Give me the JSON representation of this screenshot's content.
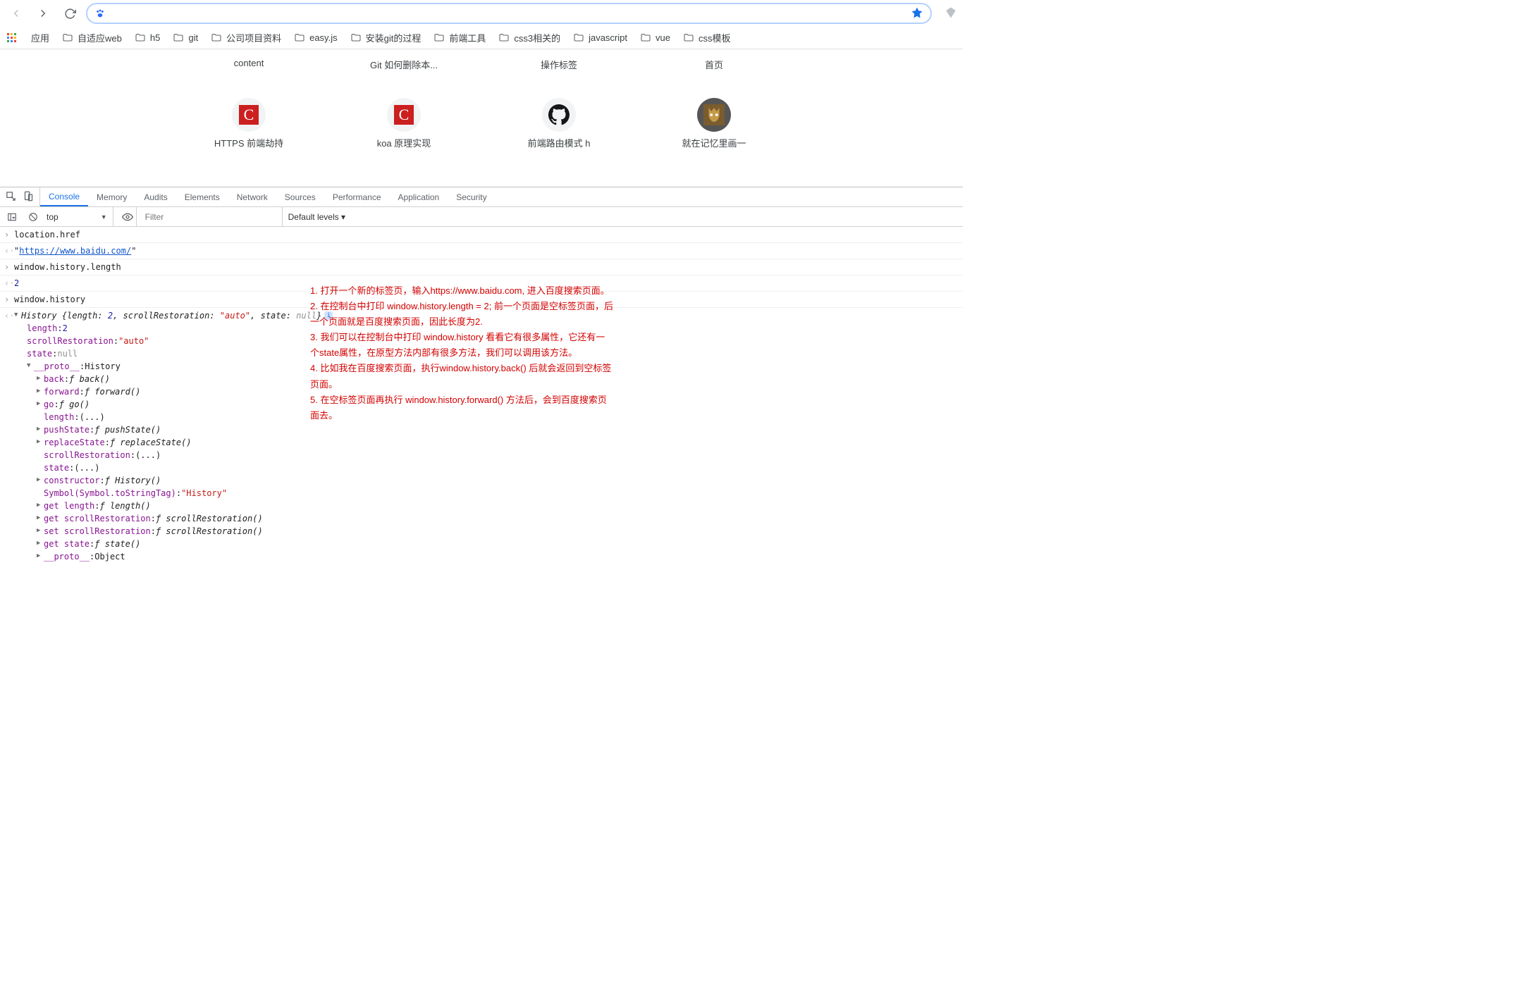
{
  "toolbar": {
    "url_value": ""
  },
  "bookmarks": {
    "apps_label": "应用",
    "items": [
      "自适应web",
      "h5",
      "git",
      "公司项目资料",
      "easy.js",
      "安装git的过程",
      "前端工具",
      "css3相关的",
      "javascript",
      "vue",
      "css模板"
    ]
  },
  "newtab": {
    "row1": [
      "content",
      "Git 如何删除本...",
      "操作标签",
      "首页"
    ],
    "row2_labels": [
      "HTTPS 前端劫持",
      "koa 原理实现",
      "前端路由模式 h",
      "就在记忆里画一"
    ]
  },
  "devtools": {
    "tabs": [
      "Console",
      "Memory",
      "Audits",
      "Elements",
      "Network",
      "Sources",
      "Performance",
      "Application",
      "Security"
    ],
    "active_tab": "Console",
    "context": "top",
    "filter_placeholder": "Filter",
    "levels": "Default levels ▾"
  },
  "console": {
    "line1_in": "location.href",
    "line1_out_prefix": "\"",
    "line1_out_link": "https://www.baidu.com/",
    "line1_out_suffix": "\"",
    "line2_in": "window.history.length",
    "line2_out": "2",
    "line3_in": "window.history",
    "history_summary_1": "History {length: ",
    "history_summary_2": "2",
    "history_summary_3": ", scrollRestoration: ",
    "history_summary_4": "\"auto\"",
    "history_summary_5": ", state: ",
    "history_summary_6": "null",
    "history_summary_7": "}",
    "props": {
      "length_k": "length",
      "length_v": "2",
      "scrollRestoration_k": "scrollRestoration",
      "scrollRestoration_v": "\"auto\"",
      "state_k": "state",
      "state_v": "null",
      "proto_k": "__proto__",
      "proto_v": "History",
      "back_k": "back",
      "back_v": "back()",
      "forward_k": "forward",
      "forward_v": "forward()",
      "go_k": "go",
      "go_v": "go()",
      "length2_k": "length",
      "length2_v": "(...)",
      "pushState_k": "pushState",
      "pushState_v": "pushState()",
      "replaceState_k": "replaceState",
      "replaceState_v": "replaceState()",
      "scrollRestoration2_k": "scrollRestoration",
      "scrollRestoration2_v": "(...)",
      "state2_k": "state",
      "state2_v": "(...)",
      "constructor_k": "constructor",
      "constructor_v": "History()",
      "symbol_k": "Symbol(Symbol.toStringTag)",
      "symbol_v": "\"History\"",
      "get_length_k": "get length",
      "get_length_v": "length()",
      "get_sr_k": "get scrollRestoration",
      "get_sr_v": "scrollRestoration()",
      "set_sr_k": "set scrollRestoration",
      "set_sr_v": "scrollRestoration()",
      "get_state_k": "get state",
      "get_state_v": "state()",
      "proto2_k": "__proto__",
      "proto2_v": "Object"
    }
  },
  "annotation": {
    "l1": "1. 打开一个新的标签页，输入https://www.baidu.com,  进入百度搜索页面。",
    "l2": "2. 在控制台中打印 window.history.length = 2;  前一个页面是空标签页面，后一个页面就是百度搜索页面，因此长度为2.",
    "l3": "3. 我们可以在控制台中打印 window.history 看看它有很多属性，它还有一个state属性，在原型方法内部有很多方法，我们可以调用该方法。",
    "l4": "4. 比如我在百度搜索页面，执行window.history.back() 后就会返回到空标签页面。",
    "l5": "5. 在空标签页面再执行 window.history.forward() 方法后，会到百度搜索页面去。"
  }
}
